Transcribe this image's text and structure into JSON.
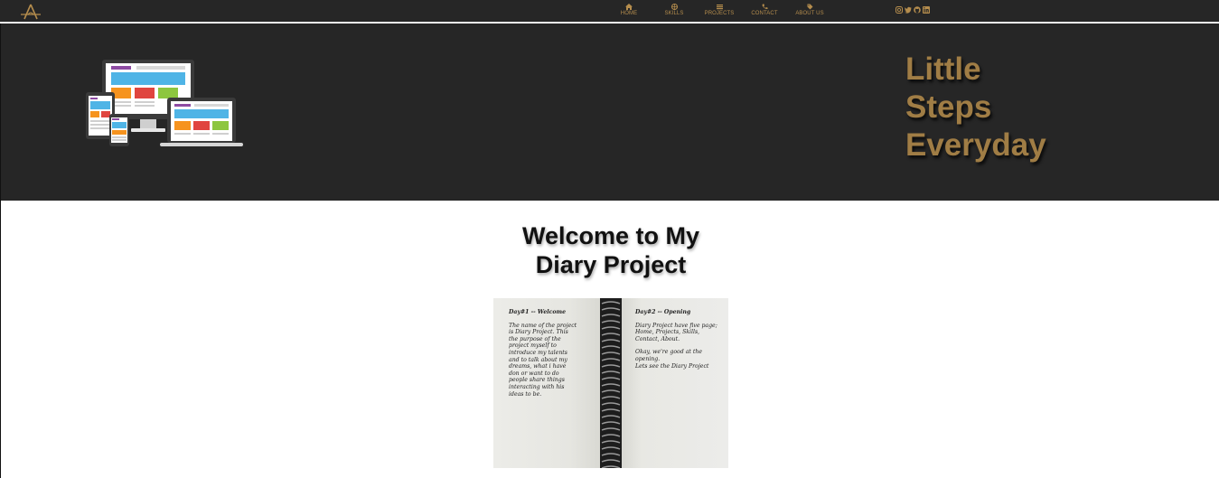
{
  "topbar": {
    "logo_icon": "a-monogram-logo-icon",
    "nav": [
      {
        "label": "HOME",
        "icon": "home-icon"
      },
      {
        "label": "SKILLS",
        "icon": "globe-icon"
      },
      {
        "label": "PROJECTS",
        "icon": "list-icon"
      },
      {
        "label": "CONTACT",
        "icon": "phone-icon"
      },
      {
        "label": "ABOUT US",
        "icon": "user-tag-icon"
      }
    ],
    "socials": [
      "instagram-icon",
      "twitter-icon",
      "github-icon",
      "linkedin-icon"
    ]
  },
  "hero": {
    "image_icon": "responsive-devices-illustration",
    "tagline": [
      "Little",
      "Steps",
      "Everyday"
    ]
  },
  "main": {
    "title_line1": "Welcome to My",
    "title_line2": "Diary Project",
    "diary": {
      "left_title": "Day#1 -- Welcome",
      "left_body": "The name of the project\nis Diary Project. This\nthe purpose of the\nproject myself to\nintroduce my talents\nand to talk about my\ndreams, what i have\ndon or want to do\npeople share things\ninteracting with his\nideas to be.",
      "right_title": "Day#2 -- Opening",
      "right_body1": "Diary Project have five page;\nHome, Projects, Skills,\nContact, About.",
      "right_body2": "Okay, we're good at the\nopening.\nLets see the Diary Project"
    }
  },
  "colors": {
    "dark_bg": "#262626",
    "gold": "#b58d4d",
    "tagline_gold": "#a07d45"
  }
}
